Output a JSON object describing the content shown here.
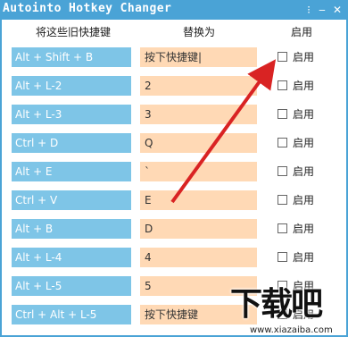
{
  "window": {
    "title": "Autointo Hotkey Changer",
    "minimize_glyph": "‒",
    "close_glyph": "✕",
    "menu_glyph": "⁝"
  },
  "headers": {
    "old_key": "将这些旧快捷键",
    "replace_with": "替换为",
    "enable": "启用"
  },
  "rows": [
    {
      "old": "Alt + Shift + B",
      "new": "按下快捷键|",
      "enable_label": "启用",
      "checked": false
    },
    {
      "old": "Alt + L-2",
      "new": "2",
      "enable_label": "启用",
      "checked": false
    },
    {
      "old": "Alt + L-3",
      "new": "3",
      "enable_label": "启用",
      "checked": false
    },
    {
      "old": "Ctrl + D",
      "new": "Q",
      "enable_label": "启用",
      "checked": false
    },
    {
      "old": "Alt + E",
      "new": "`",
      "enable_label": "启用",
      "checked": false
    },
    {
      "old": "Ctrl + V",
      "new": "E",
      "enable_label": "启用",
      "checked": false
    },
    {
      "old": "Alt + B",
      "new": "D",
      "enable_label": "启用",
      "checked": false
    },
    {
      "old": "Alt + L-4",
      "new": "4",
      "enable_label": "启用",
      "checked": false
    },
    {
      "old": "Alt + L-5",
      "new": "5",
      "enable_label": "启用",
      "checked": false
    },
    {
      "old": "Ctrl + Alt + L-5",
      "new": "按下快捷键",
      "enable_label": "启用",
      "checked": false
    }
  ],
  "watermark": {
    "logo_text": "下载吧",
    "url": "www.xiazaiba.com"
  },
  "colors": {
    "title_bar": "#4aa3d6",
    "old_key_bg": "#7ec5e7",
    "new_key_bg": "#ffd9b5",
    "arrow": "#d92323"
  }
}
